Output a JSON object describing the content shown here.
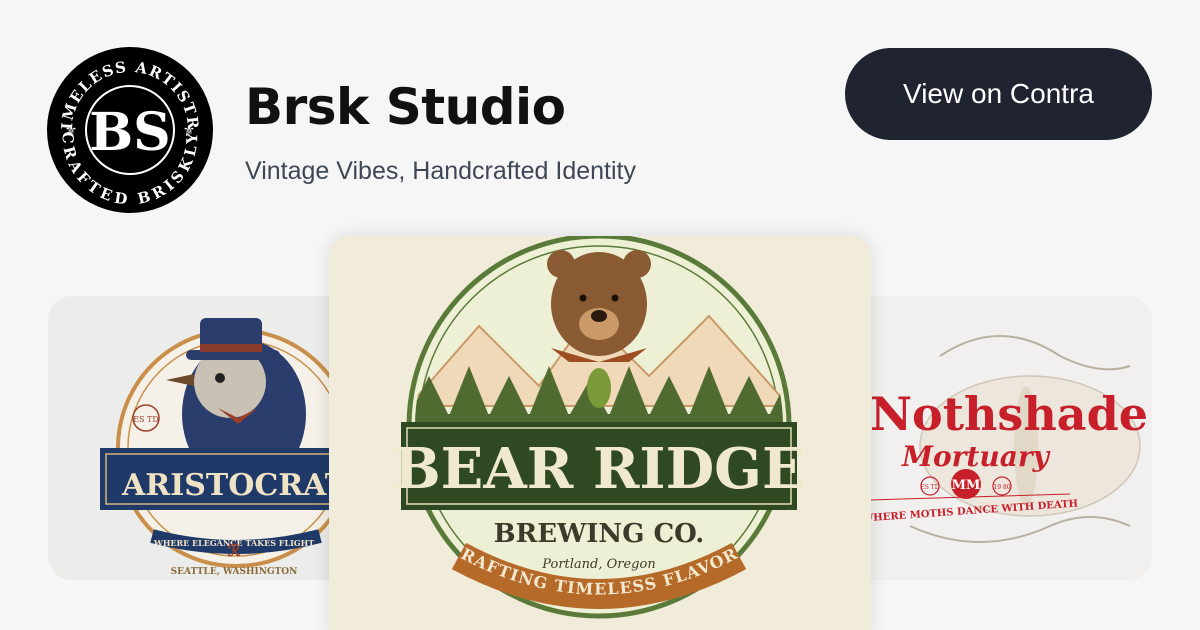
{
  "profile": {
    "name": "Brsk Studio",
    "tagline": "Vintage Vibes, Handcrafted Identity",
    "avatar": {
      "ring_top": "TIMELESS ARTISTRY",
      "ring_bottom": "CRAFTED BRISKLY",
      "monogram": "BS"
    }
  },
  "cta": {
    "label": "View on Contra"
  },
  "colors": {
    "cta_bg": "#1f2430",
    "page_bg": "#f6f6f6",
    "title": "#111111",
    "subtitle": "#3f4756"
  },
  "portfolio": {
    "left": {
      "title": "ARISTOCRAT AVIA",
      "est": "ES TD",
      "tagline": "WHERE ELEGANCE TAKES FLIGHT",
      "location": "SEATTLE, WASHINGTON"
    },
    "center": {
      "title": "BEAR RIDGE",
      "subtitle": "BREWING CO.",
      "location": "Portland, Oregon",
      "banner": "CRAFTING TIMELESS FLAVORS"
    },
    "right": {
      "title": "Nothshade",
      "subtitle": "Mortuary",
      "monogram": "MM",
      "est": "ES TD",
      "year": "19 80",
      "tagline": "WHERE MOTHS DANCE WITH DEATH"
    }
  }
}
